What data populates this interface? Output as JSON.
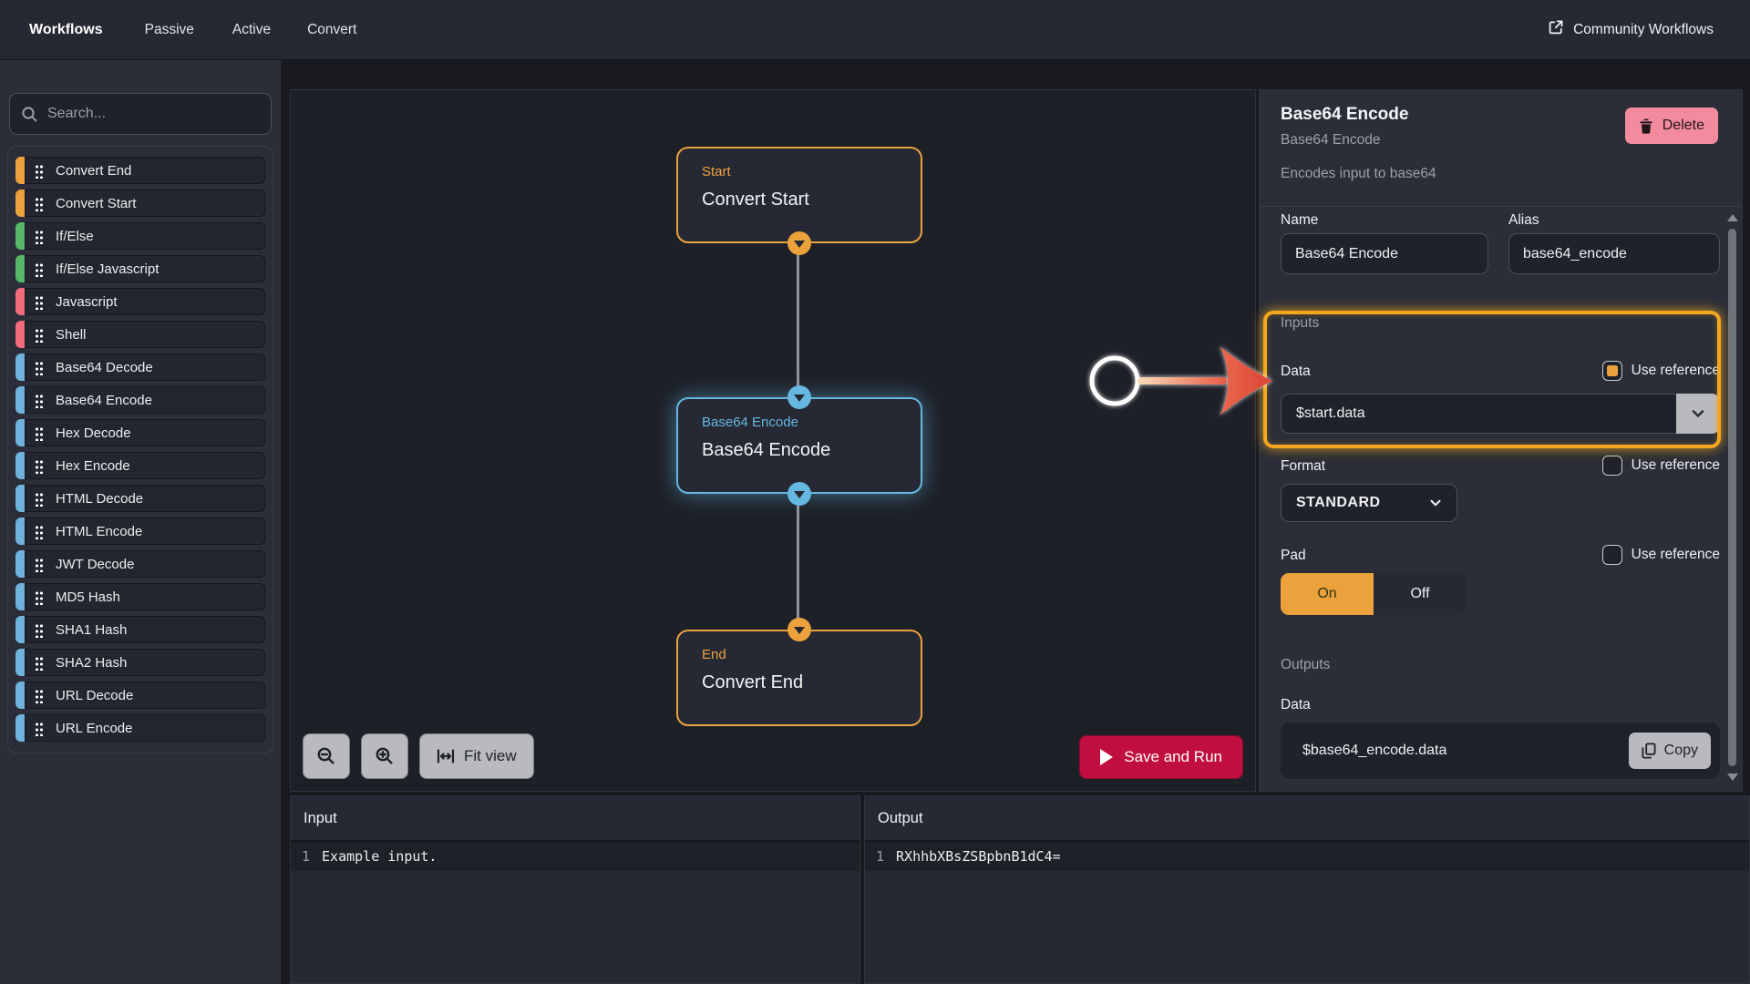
{
  "topbar": {
    "brand": "Workflows",
    "tabs": [
      "Passive",
      "Active",
      "Convert"
    ],
    "community_link": "Community Workflows"
  },
  "sidebar": {
    "search_placeholder": "Search...",
    "items": [
      {
        "label": "Convert End",
        "color": "#eba23d"
      },
      {
        "label": "Convert Start",
        "color": "#eba23d"
      },
      {
        "label": "If/Else",
        "color": "#57b667"
      },
      {
        "label": "If/Else Javascript",
        "color": "#57b667"
      },
      {
        "label": "Javascript",
        "color": "#f16d7e"
      },
      {
        "label": "Shell",
        "color": "#f16d7e"
      },
      {
        "label": "Base64 Decode",
        "color": "#6fb3dd"
      },
      {
        "label": "Base64 Encode",
        "color": "#6fb3dd"
      },
      {
        "label": "Hex Decode",
        "color": "#6fb3dd"
      },
      {
        "label": "Hex Encode",
        "color": "#6fb3dd"
      },
      {
        "label": "HTML Decode",
        "color": "#6fb3dd"
      },
      {
        "label": "HTML Encode",
        "color": "#6fb3dd"
      },
      {
        "label": "JWT Decode",
        "color": "#6fb3dd"
      },
      {
        "label": "MD5 Hash",
        "color": "#6fb3dd"
      },
      {
        "label": "SHA1 Hash",
        "color": "#6fb3dd"
      },
      {
        "label": "SHA2 Hash",
        "color": "#6fb3dd"
      },
      {
        "label": "URL Decode",
        "color": "#6fb3dd"
      },
      {
        "label": "URL Encode",
        "color": "#6fb3dd"
      }
    ]
  },
  "canvas": {
    "nodes": [
      {
        "type": "Start",
        "name": "Convert Start",
        "accent": "#eba23d",
        "selected": false
      },
      {
        "type": "Base64 Encode",
        "name": "Base64 Encode",
        "accent": "#66b7e2",
        "selected": true
      },
      {
        "type": "End",
        "name": "Convert End",
        "accent": "#eba23d",
        "selected": false
      }
    ],
    "fit_view_label": "Fit view",
    "save_and_run_label": "Save and Run"
  },
  "inspector": {
    "title": "Base64 Encode",
    "subtitle": "Base64 Encode",
    "description": "Encodes input to base64",
    "delete_label": "Delete",
    "name_label": "Name",
    "name_value": "Base64 Encode",
    "alias_label": "Alias",
    "alias_value": "base64_encode",
    "inputs_heading": "Inputs",
    "outputs_heading": "Outputs",
    "use_reference_label": "Use reference",
    "fields": {
      "data": {
        "label": "Data",
        "value": "$start.data",
        "use_reference": true
      },
      "format": {
        "label": "Format",
        "value": "STANDARD",
        "use_reference": false
      },
      "pad": {
        "label": "Pad",
        "on_label": "On",
        "off_label": "Off",
        "selected": "On",
        "use_reference": false
      }
    },
    "output": {
      "label": "Data",
      "value": "$base64_encode.data",
      "copy_label": "Copy"
    }
  },
  "io": {
    "input": {
      "title": "Input",
      "line_number": "1",
      "content": "Example input."
    },
    "output": {
      "title": "Output",
      "line_number": "1",
      "content": "RXhhbXBsZSBpbnB1dC4="
    }
  },
  "icons": {
    "search": "magnifier",
    "community": "external-link",
    "delete": "trash",
    "copy": "copy",
    "zoom_out": "magnifier-minus",
    "zoom_in": "magnifier-plus",
    "fit": "fit-width",
    "run": "play",
    "dropdown": "chevron-down",
    "grip": "drag-handle"
  },
  "colors": {
    "accent_orange": "#eba23d",
    "accent_blue": "#66b7e2",
    "accent_green": "#57b667",
    "accent_red": "#f16d7e",
    "run_button": "#c00f3f",
    "delete_button": "#f28b9d",
    "light_button": "#b9babe",
    "highlight_annotation": "#f4a820"
  }
}
